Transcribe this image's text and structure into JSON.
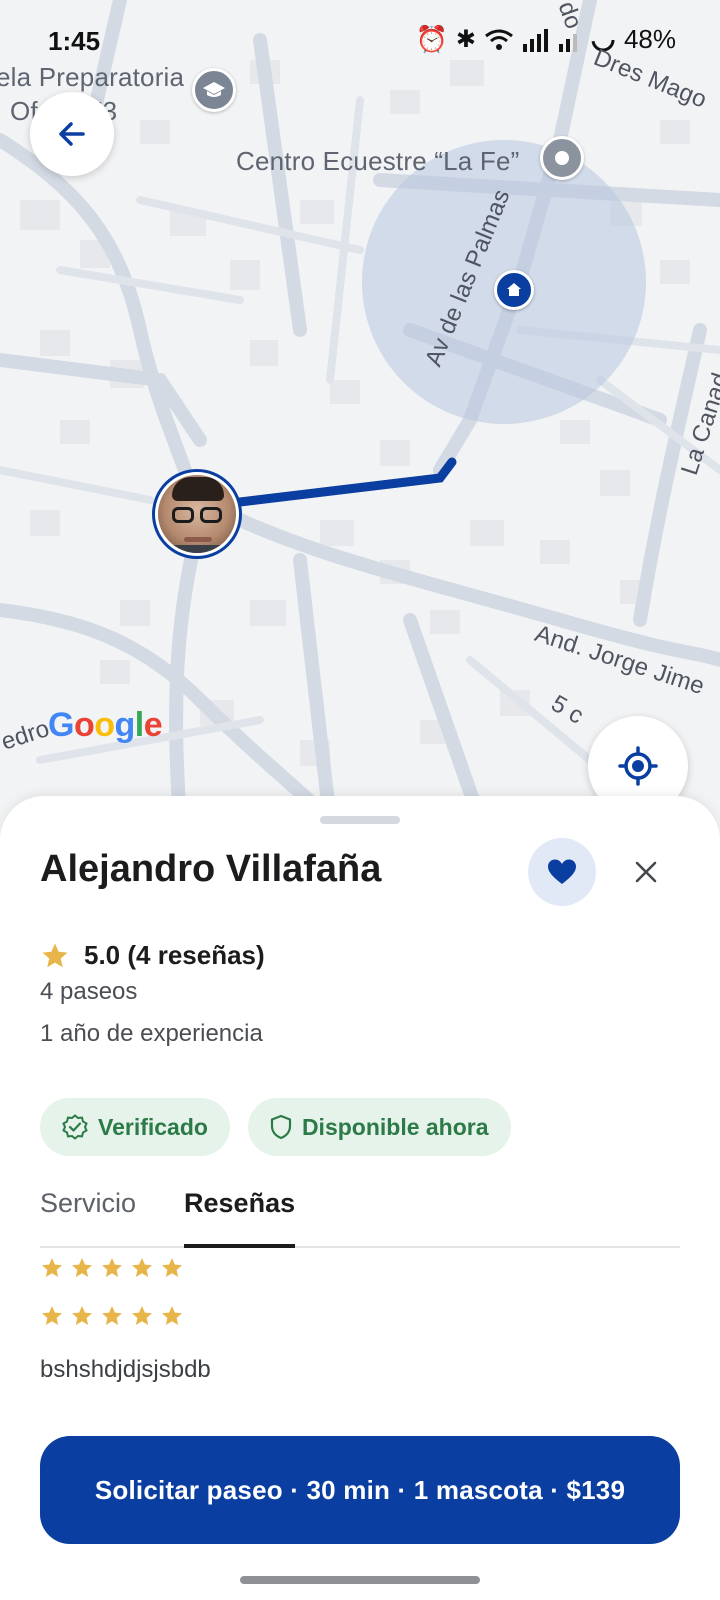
{
  "status_bar": {
    "time": "1:45",
    "battery": "48%"
  },
  "map": {
    "labels": {
      "school_line1": "ela Preparatoria",
      "school_line2": "Of          lo.273",
      "equestrian": "Centro Ecuestre “La Fe”",
      "av_palmas": "Av de las Palmas",
      "la_canada": "La Canad",
      "jorge": "And. Jorge Jime",
      "cdro": "edro",
      "five": "5 c",
      "dres": "Dres Mago",
      "do": "do"
    },
    "google_logo": {
      "letters": [
        "G",
        "o",
        "o",
        "g",
        "l",
        "e"
      ],
      "colors": [
        "#4285F4",
        "#EA4335",
        "#FBBC05",
        "#4285F4",
        "#34A853",
        "#EA4335"
      ]
    }
  },
  "walker": {
    "name": "Alejandro Villafaña",
    "rating": "5.0 (4 reseñas)",
    "walks": "4 paseos",
    "experience": "1 año de experiencia",
    "badges": {
      "verified": "Verificado",
      "available": "Disponible ahora"
    }
  },
  "tabs": {
    "service": "Servicio",
    "reviews": "Reseñas",
    "active": "reviews"
  },
  "reviews": [
    {
      "stars": 5,
      "text": ""
    },
    {
      "stars": 5,
      "text": "bshshdjdjsjsbdb"
    }
  ],
  "cta": {
    "label": "Solicitar paseo · 30 min · 1 mascota · $139"
  },
  "colors": {
    "primary": "#0a3ea0",
    "star": "#e8b54a",
    "badge_bg": "#e6f3ea",
    "badge_text": "#2c7a47"
  },
  "icons": {
    "back": "arrow-left-icon",
    "favorite": "heart-icon",
    "close": "close-icon",
    "locate": "my-location-icon",
    "home": "home-icon",
    "verified": "verified-badge-icon",
    "available": "shield-icon",
    "star": "star-icon"
  }
}
